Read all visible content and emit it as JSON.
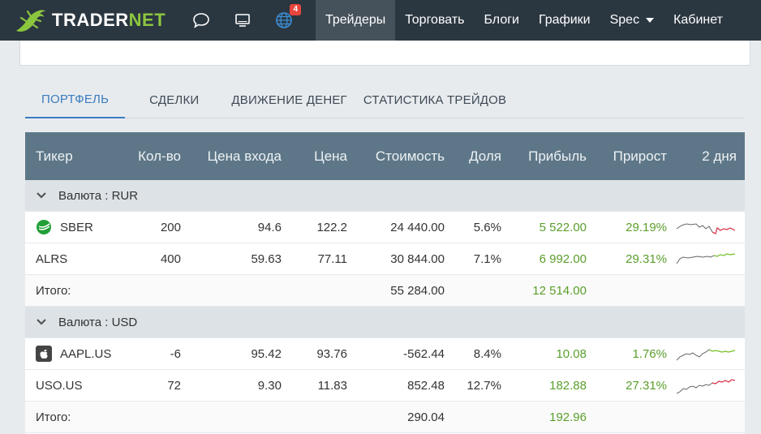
{
  "nav": {
    "logo_text_main": "TRADER",
    "logo_text_accent": "NET",
    "notification_count": "4",
    "items": [
      {
        "label": "Трейдеры",
        "active": true
      },
      {
        "label": "Торговать"
      },
      {
        "label": "Блоги"
      },
      {
        "label": "Графики"
      },
      {
        "label": "Spec",
        "has_dropdown": true
      },
      {
        "label": "Кабинет"
      }
    ],
    "icons": [
      "chat-bubble-icon",
      "monitor-icon",
      "globe-icon"
    ]
  },
  "tabs": [
    {
      "label": "ПОРТФЕЛЬ",
      "active": true
    },
    {
      "label": "СДЕЛКИ"
    },
    {
      "label": "ДВИЖЕНИЕ ДЕНЕГ"
    },
    {
      "label": "СТАТИСТИКА ТРЕЙДОВ"
    }
  ],
  "table": {
    "columns": [
      "Тикер",
      "Кол-во",
      "Цена входа",
      "Цена",
      "Стоимость",
      "Доля",
      "Прибыль",
      "Прирост",
      "2 дня"
    ],
    "groups": [
      {
        "label": "Валюта : RUR",
        "rows": [
          {
            "ticker": "SBER",
            "icon": "sberbank-logo-icon",
            "qty": "200",
            "entry": "94.6",
            "price": "122.2",
            "value": "24 440.00",
            "share": "5.6%",
            "profit": "5 522.00",
            "growth": "29.19%",
            "spark_trend": "down-red"
          },
          {
            "ticker": "ALRS",
            "icon": "",
            "qty": "400",
            "entry": "59.63",
            "price": "77.11",
            "value": "30 844.00",
            "share": "7.1%",
            "profit": "6 992.00",
            "growth": "29.31%",
            "spark_trend": "up-green"
          }
        ],
        "total": {
          "label": "Итого:",
          "value": "55 284.00",
          "profit": "12 514.00"
        }
      },
      {
        "label": "Валюта : USD",
        "rows": [
          {
            "ticker": "AAPL.US",
            "icon": "apple-logo-icon",
            "qty": "-6",
            "entry": "95.42",
            "price": "93.76",
            "value": "-562.44",
            "share": "8.4%",
            "profit": "10.08",
            "growth": "1.76%",
            "spark_trend": "up-green"
          },
          {
            "ticker": "USO.US",
            "icon": "",
            "qty": "72",
            "entry": "9.30",
            "price": "11.83",
            "value": "852.48",
            "share": "12.7%",
            "profit": "182.88",
            "growth": "27.31%",
            "spark_trend": "up-red"
          }
        ],
        "total": {
          "label": "Итого:",
          "value": "290.04",
          "profit": "192.96"
        }
      }
    ]
  },
  "colors": {
    "navbar": "#2b3740",
    "table_header": "#5e7788",
    "accent_blue": "#3a7cbf",
    "profit_green": "#5a9e2b",
    "spark_red": "#e0344b",
    "spark_green": "#7cc72c"
  }
}
